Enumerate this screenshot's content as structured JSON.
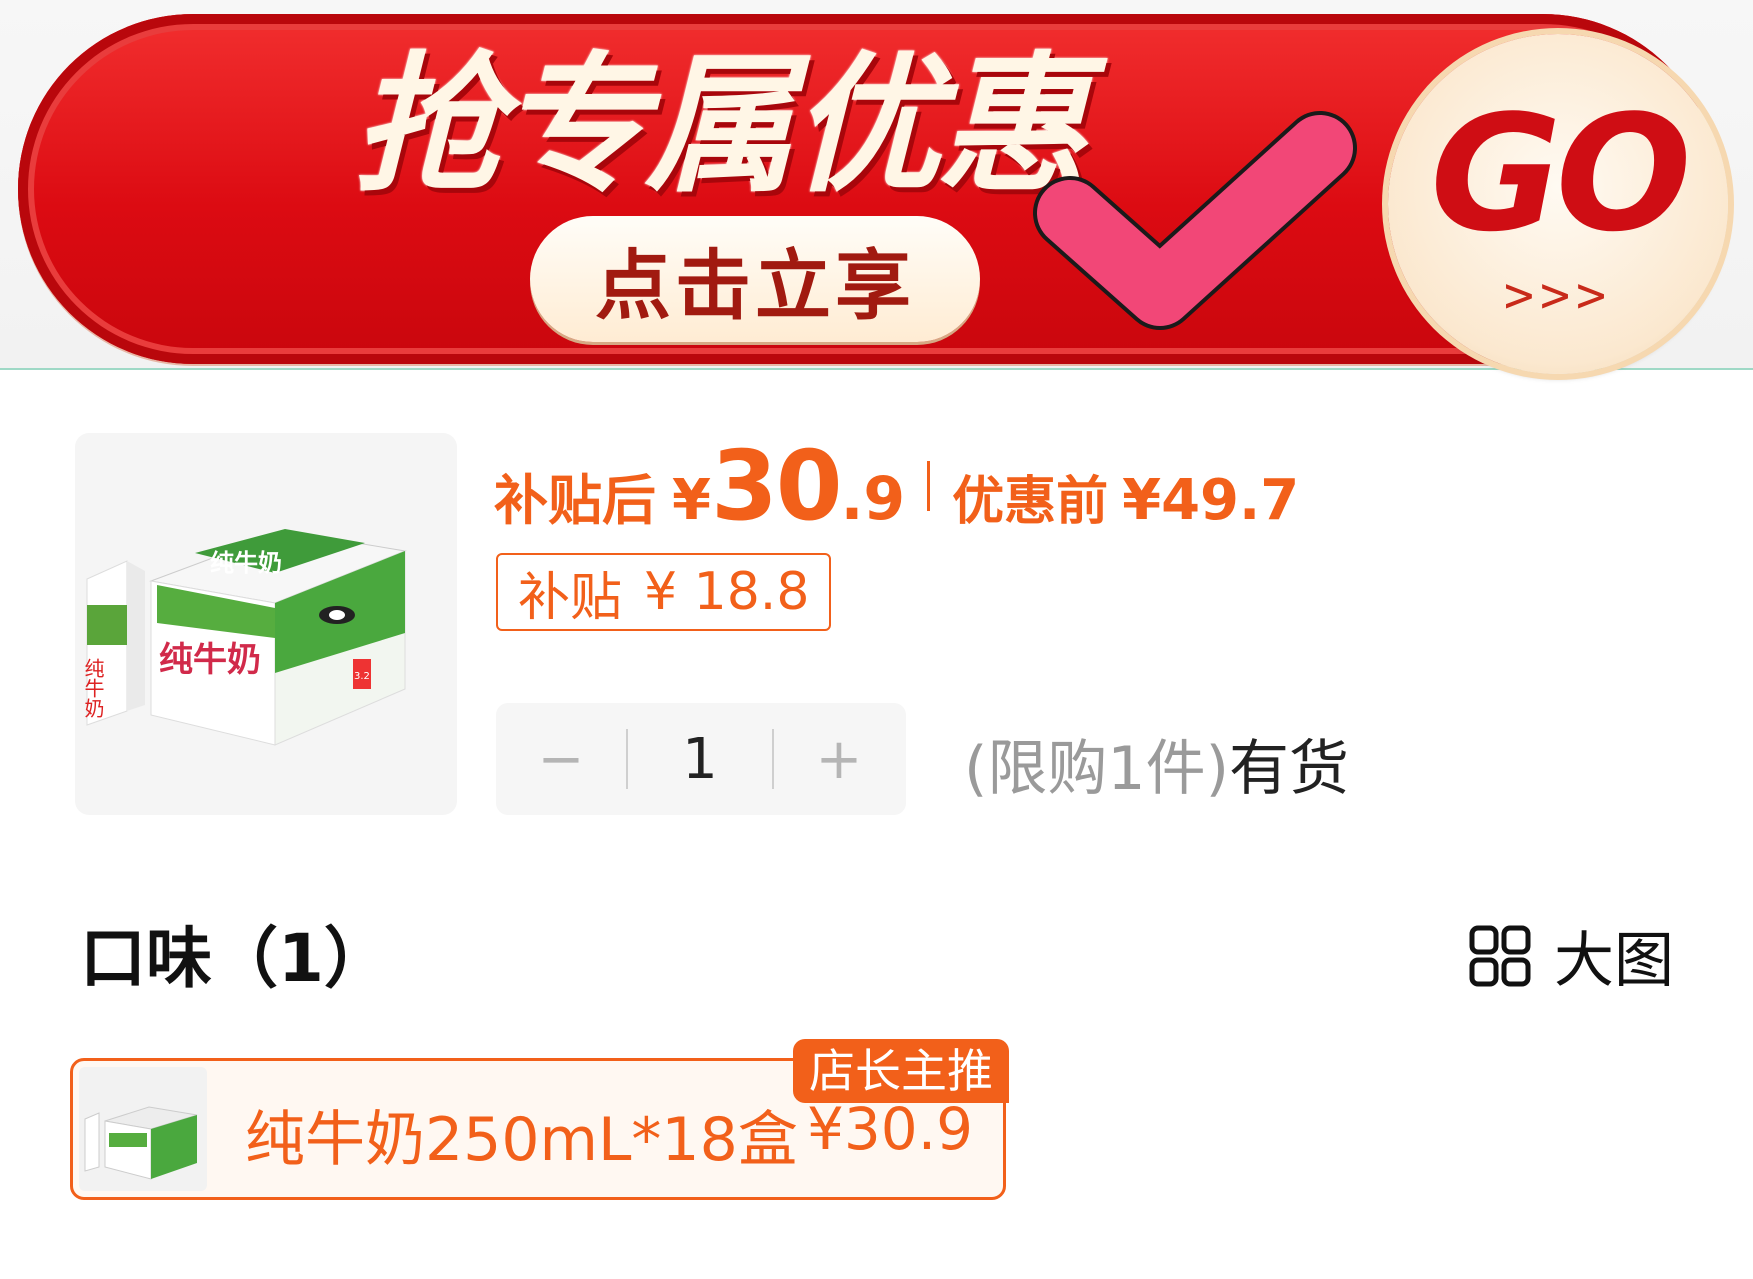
{
  "banner": {
    "title": "抢专属优惠",
    "claim_label": "点击立享",
    "go_label": "GO",
    "go_arrows": ">>>"
  },
  "product": {
    "price_after_label": "补贴后",
    "currency": "¥",
    "price_int": "30",
    "price_dec": ".9",
    "price_before_label": "优惠前",
    "price_before": "¥49.7",
    "subsidy_label": "补贴",
    "subsidy_amount": "¥ 18.8",
    "quantity": "1",
    "minus": "−",
    "plus": "+",
    "limit_text": "(限购1件)",
    "stock_text": "有货",
    "image_texts": [
      "纯牛奶",
      "纯牛奶",
      "纯牛奶",
      "3.2"
    ]
  },
  "flavor": {
    "title": "口味（1）",
    "bigview_label": "大图",
    "sku": {
      "name": "纯牛奶250mL*18盒",
      "price": "¥30.9",
      "badge": "店长主推"
    }
  },
  "colors": {
    "accent": "#f2601a",
    "banner_red": "#dc0b12",
    "check_pink": "#f24777"
  },
  "icons": [
    "check-icon",
    "grid-icon",
    "minus-icon",
    "plus-icon"
  ]
}
